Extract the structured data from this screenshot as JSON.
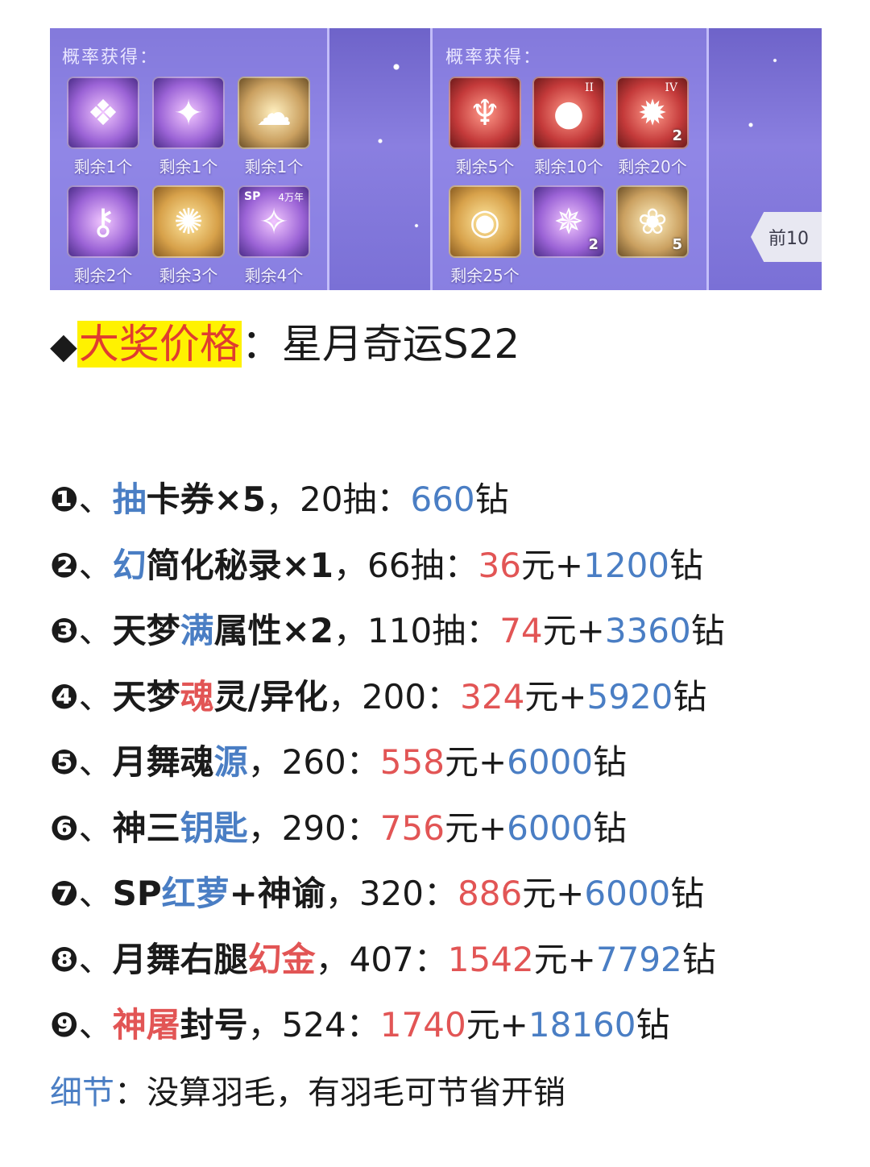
{
  "banner": {
    "left_panel": {
      "title": "概率获得：",
      "items": [
        {
          "icon": "treasure-chest-icon",
          "count": "剩余1个"
        },
        {
          "icon": "dragon-icon",
          "count": "剩余1个"
        },
        {
          "icon": "cloud-emblem-icon",
          "count": "剩余1个"
        },
        {
          "icon": "key-icon",
          "count": "剩余2个"
        },
        {
          "icon": "beast-emblem-icon",
          "count": "剩余3个"
        },
        {
          "icon": "sp-soul-card-icon",
          "count": "剩余4个",
          "sp": "SP",
          "age": "4万年"
        }
      ]
    },
    "right_panel": {
      "title": "概率获得：",
      "items": [
        {
          "icon": "trident-icon",
          "count": "剩余5个"
        },
        {
          "icon": "red-orb-icon",
          "count": "剩余10个",
          "roman": "II"
        },
        {
          "icon": "red-emblem-icon",
          "count": "剩余20个",
          "roman": "IV",
          "badge": "2"
        },
        {
          "icon": "gold-coin-icon",
          "count": "剩余25个"
        },
        {
          "icon": "winged-crest-icon",
          "badge": "2"
        },
        {
          "icon": "lotus-crest-icon",
          "badge": "5"
        }
      ]
    },
    "side_button": "前10"
  },
  "heading": {
    "diamond": "◆",
    "highlight": "大奖价格",
    "rest": "：星月奇运S22"
  },
  "items": [
    {
      "num": "❶",
      "sep": "、",
      "parts": [
        {
          "t": "抽",
          "c": "blue"
        },
        {
          "t": "卡券×5",
          "c": "bold"
        }
      ],
      "draws": "，20抽：",
      "price": [
        {
          "t": "660",
          "c": "blue"
        },
        {
          "t": "钻",
          "c": "plain"
        }
      ]
    },
    {
      "num": "❷",
      "sep": "、",
      "parts": [
        {
          "t": "幻",
          "c": "blue"
        },
        {
          "t": "简化秘录×1",
          "c": "bold"
        }
      ],
      "draws": "，66抽：",
      "price": [
        {
          "t": "36",
          "c": "red"
        },
        {
          "t": "元+",
          "c": "plain"
        },
        {
          "t": "1200",
          "c": "blue"
        },
        {
          "t": "钻",
          "c": "plain"
        }
      ]
    },
    {
      "num": "❸",
      "sep": "、",
      "parts": [
        {
          "t": "天梦",
          "c": "bold"
        },
        {
          "t": "满",
          "c": "blue"
        },
        {
          "t": "属性×2",
          "c": "bold"
        }
      ],
      "draws": "，110抽：",
      "price": [
        {
          "t": "74",
          "c": "red"
        },
        {
          "t": "元+",
          "c": "plain"
        },
        {
          "t": "3360",
          "c": "blue"
        },
        {
          "t": "钻",
          "c": "plain"
        }
      ]
    },
    {
      "num": "❹",
      "sep": "、",
      "parts": [
        {
          "t": "天梦",
          "c": "bold"
        },
        {
          "t": "魂",
          "c": "red"
        },
        {
          "t": "灵/异化",
          "c": "bold"
        }
      ],
      "draws": "，200：",
      "price": [
        {
          "t": "324",
          "c": "red"
        },
        {
          "t": "元+",
          "c": "plain"
        },
        {
          "t": "5920",
          "c": "blue"
        },
        {
          "t": "钻",
          "c": "plain"
        }
      ]
    },
    {
      "num": "❺",
      "sep": "、",
      "parts": [
        {
          "t": "月舞魂",
          "c": "bold"
        },
        {
          "t": "源",
          "c": "blue"
        }
      ],
      "draws": "，260：",
      "price": [
        {
          "t": "558",
          "c": "red"
        },
        {
          "t": "元+",
          "c": "plain"
        },
        {
          "t": "6000",
          "c": "blue"
        },
        {
          "t": "钻",
          "c": "plain"
        }
      ]
    },
    {
      "num": "❻",
      "sep": "、",
      "parts": [
        {
          "t": "神三",
          "c": "bold"
        },
        {
          "t": "钥匙",
          "c": "blue"
        }
      ],
      "draws": "，290：",
      "price": [
        {
          "t": "756",
          "c": "red"
        },
        {
          "t": "元+",
          "c": "plain"
        },
        {
          "t": "6000",
          "c": "blue"
        },
        {
          "t": "钻",
          "c": "plain"
        }
      ]
    },
    {
      "num": "❼",
      "sep": "、",
      "parts": [
        {
          "t": "SP",
          "c": "bold"
        },
        {
          "t": "红萝",
          "c": "blue"
        },
        {
          "t": "+神谕",
          "c": "bold"
        }
      ],
      "draws": "，320：",
      "price": [
        {
          "t": "886",
          "c": "red"
        },
        {
          "t": "元+",
          "c": "plain"
        },
        {
          "t": "6000",
          "c": "blue"
        },
        {
          "t": "钻",
          "c": "plain"
        }
      ]
    },
    {
      "num": "❽",
      "sep": "、",
      "parts": [
        {
          "t": "月舞右腿",
          "c": "bold"
        },
        {
          "t": "幻金",
          "c": "red"
        }
      ],
      "draws": "，407：",
      "price": [
        {
          "t": "1542",
          "c": "red"
        },
        {
          "t": "元+",
          "c": "plain"
        },
        {
          "t": "7792",
          "c": "blue"
        },
        {
          "t": "钻",
          "c": "plain"
        }
      ]
    },
    {
      "num": "❾",
      "sep": "、",
      "parts": [
        {
          "t": "神屠",
          "c": "red"
        },
        {
          "t": "封号",
          "c": "bold"
        }
      ],
      "draws": "，524：",
      "price": [
        {
          "t": "1740",
          "c": "red"
        },
        {
          "t": "元+",
          "c": "plain"
        },
        {
          "t": "18160",
          "c": "blue"
        },
        {
          "t": "钻",
          "c": "plain"
        }
      ]
    }
  ],
  "detail": {
    "label": "细节",
    "text": "：没算羽毛，有羽毛可节省开销"
  },
  "colors": {
    "blue": "#4a7ec4",
    "red": "#e25555",
    "highlight": "#fff200"
  }
}
